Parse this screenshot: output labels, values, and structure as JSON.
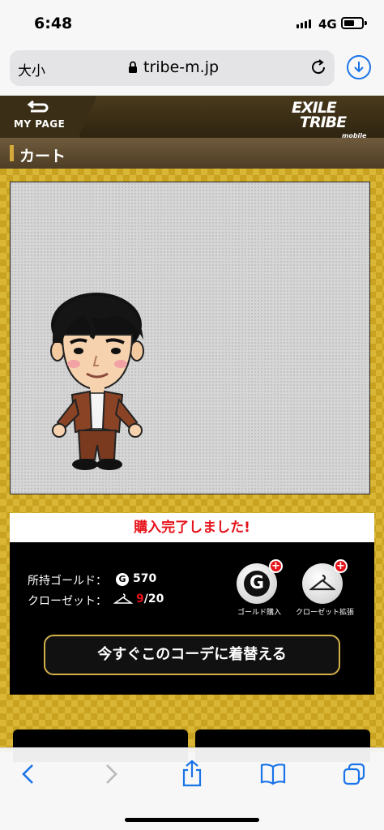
{
  "status": {
    "time": "6:48",
    "network": "4G"
  },
  "browser": {
    "text_size": "大小",
    "url": "tribe-m.jp"
  },
  "header": {
    "mypage_label": "MY PAGE",
    "logo_line1": "EXILE",
    "logo_line2": "TRIBE",
    "logo_line3": "mobile"
  },
  "page": {
    "title": "カート"
  },
  "result": {
    "message": "購入完了しました!"
  },
  "account": {
    "gold_label": "所持ゴールド：",
    "gold_value": "570",
    "closet_label": "クローゼット：",
    "closet_used": "9",
    "closet_total": "/20"
  },
  "actions": {
    "gold_buy_label": "ゴールド購入",
    "closet_expand_label": "クローゼット拡張",
    "change_outfit_label": "今すぐこのコーデに着替える"
  },
  "icons": [
    "back-icon",
    "forward-icon",
    "share-icon",
    "bookmarks-icon",
    "tabs-icon",
    "lock-icon",
    "reload-icon",
    "download-icon",
    "hanger-icon"
  ],
  "colors": {
    "accent_red": "#e6121a",
    "gold": "#c9a220",
    "browser_blue": "#1a73e8"
  }
}
